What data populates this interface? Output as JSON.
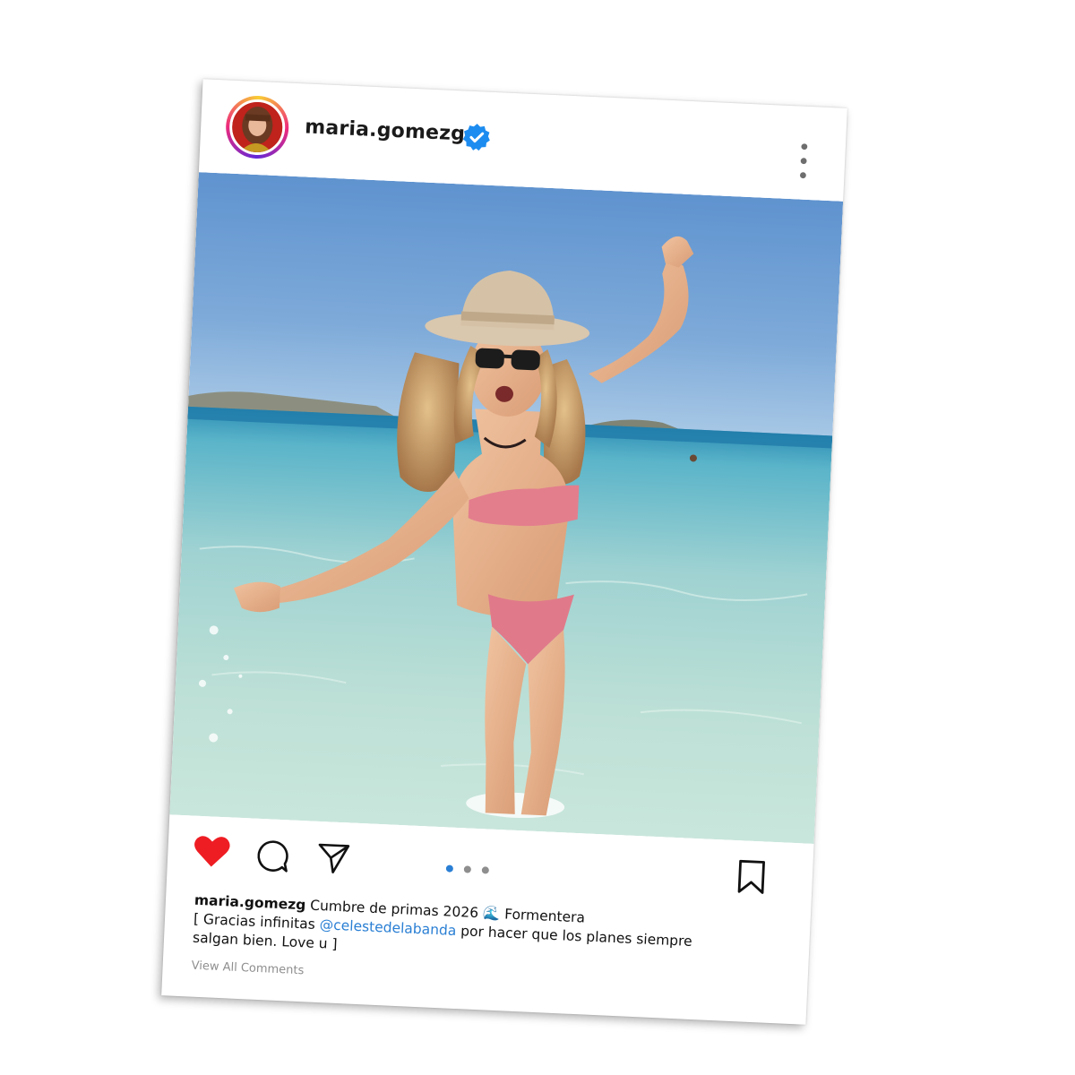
{
  "post": {
    "username": "maria.gomezg",
    "verified": true,
    "caption": {
      "username": "maria.gomezg",
      "text_before_emoji": "Cumbre de primas 2026",
      "emoji": "🌊",
      "text_after_emoji": "Formentera",
      "line2_before": "[ Gracias infinitas",
      "mention": "@celestedelabanda",
      "line2_after": "por hacer que los planes siempre",
      "line3": "salgan bien. Love u ]"
    },
    "view_comments_label": "View All Comments",
    "liked": true,
    "carousel": {
      "count": 3,
      "active_index": 0
    }
  },
  "icons": {
    "more": "more-vertical-icon",
    "like": "heart-icon",
    "comment": "comment-bubble-icon",
    "share": "paper-plane-icon",
    "save": "bookmark-icon",
    "verified": "verified-badge-icon"
  },
  "colors": {
    "like": "#ee1d23",
    "verified": "#1d8cf0",
    "mention": "#2a7fd4",
    "carousel_active": "#2a7fd4",
    "carousel_inactive": "#8e8e8e"
  }
}
